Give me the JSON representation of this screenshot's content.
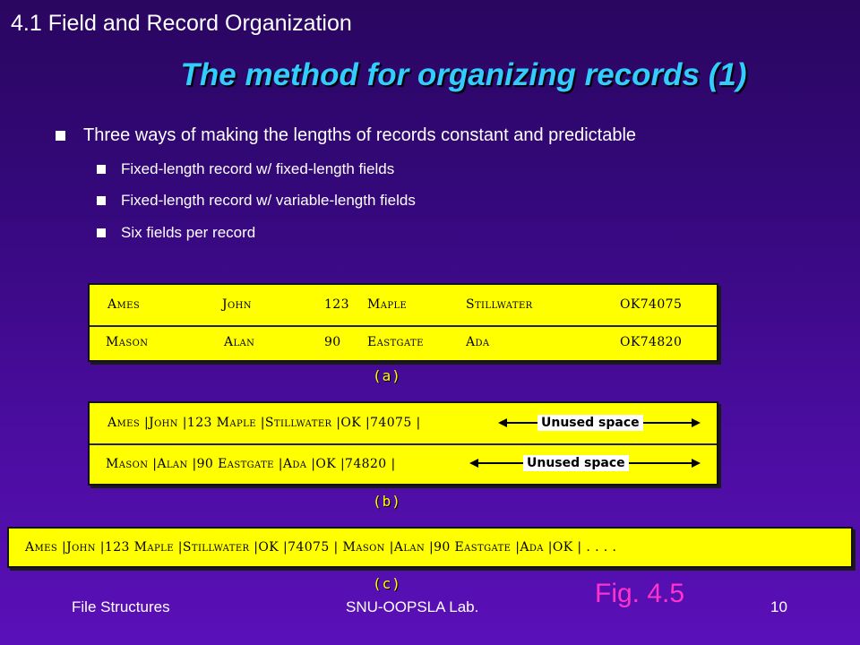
{
  "header": {
    "section": "4.1 Field and Record Organization",
    "title": "The method for organizing records (1)"
  },
  "bullets": {
    "main": "Three ways of making the lengths of records constant and predictable",
    "sub": [
      "Fixed-length record w/ fixed-length fields",
      "Fixed-length record w/ variable-length fields",
      "Six fields per record"
    ]
  },
  "figure": {
    "a": {
      "rows": [
        [
          "Ames",
          "John",
          "123",
          "Maple",
          "Stillwater",
          "OK74075"
        ],
        [
          "Mason",
          "Alan",
          "90",
          "Eastgate",
          "Ada",
          "OK74820"
        ]
      ],
      "caption": "(a)"
    },
    "b": {
      "rows": [
        "Ames |John |123 Maple |Stillwater |OK |74075 |",
        "Mason |Alan |90 Eastgate |Ada |OK |74820 |"
      ],
      "unused_label": "Unused space",
      "caption": "(b)"
    },
    "c": {
      "text": "Ames |John |123 Maple |Stillwater |OK |74075 | Mason |Alan |90 Eastgate |Ada |OK | . . . .",
      "caption": "(c)"
    },
    "label": "Fig. 4.5"
  },
  "footer": {
    "left": "File Structures",
    "center": "SNU-OOPSLA Lab.",
    "page": "10"
  },
  "colors": {
    "title": "#33ccff",
    "box": "#ffff00",
    "fig_label": "#ff33cc"
  }
}
